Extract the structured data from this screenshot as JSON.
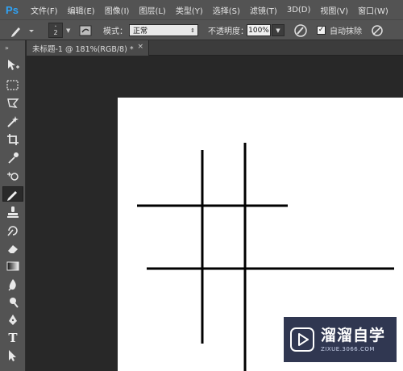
{
  "app": {
    "logo": "Ps"
  },
  "menubar": {
    "items": [
      {
        "label": "文件(F)"
      },
      {
        "label": "编辑(E)"
      },
      {
        "label": "图像(I)"
      },
      {
        "label": "图层(L)"
      },
      {
        "label": "类型(Y)"
      },
      {
        "label": "选择(S)"
      },
      {
        "label": "滤镜(T)"
      },
      {
        "label": "3D(D)"
      },
      {
        "label": "视图(V)"
      },
      {
        "label": "窗口(W)"
      }
    ]
  },
  "options_bar": {
    "tool_icon": "brush-icon",
    "brush_size": "2",
    "mode_label": "模式：",
    "mode_value": "正常",
    "opacity_label": "不透明度：",
    "opacity_value": "100%",
    "auto_erase_checked": true,
    "auto_erase_label": "自动抹除"
  },
  "document": {
    "tab_title": "未标题-1 @ 181%(RGB/8) *",
    "close_glyph": "×",
    "canvas_background": "#ffffff",
    "stroke_color": "#000000"
  },
  "tools": [
    {
      "name": "move-tool-icon",
      "active": false
    },
    {
      "name": "marquee-tool-icon",
      "active": false
    },
    {
      "name": "lasso-tool-icon",
      "active": false
    },
    {
      "name": "magic-wand-tool-icon",
      "active": false
    },
    {
      "name": "crop-tool-icon",
      "active": false
    },
    {
      "name": "eyedropper-tool-icon",
      "active": false
    },
    {
      "name": "healing-brush-tool-icon",
      "active": false
    },
    {
      "name": "pencil-tool-icon",
      "active": true
    },
    {
      "name": "clone-stamp-tool-icon",
      "active": false
    },
    {
      "name": "history-brush-tool-icon",
      "active": false
    },
    {
      "name": "eraser-tool-icon",
      "active": false
    },
    {
      "name": "gradient-tool-icon",
      "active": false
    },
    {
      "name": "blur-tool-icon",
      "active": false
    },
    {
      "name": "dodge-tool-icon",
      "active": false
    },
    {
      "name": "pen-tool-icon",
      "active": false
    },
    {
      "name": "type-tool-icon",
      "active": false
    },
    {
      "name": "path-selection-tool-icon",
      "active": false
    }
  ],
  "type_tool_glyph": "T",
  "watermark": {
    "title": "溜溜自学",
    "url": "ZIXUE.3066.COM"
  },
  "colors": {
    "ps_blue": "#2fa3f6",
    "panel": "#535353",
    "workspace": "#282828",
    "watermark_bg": "#20284"
  }
}
